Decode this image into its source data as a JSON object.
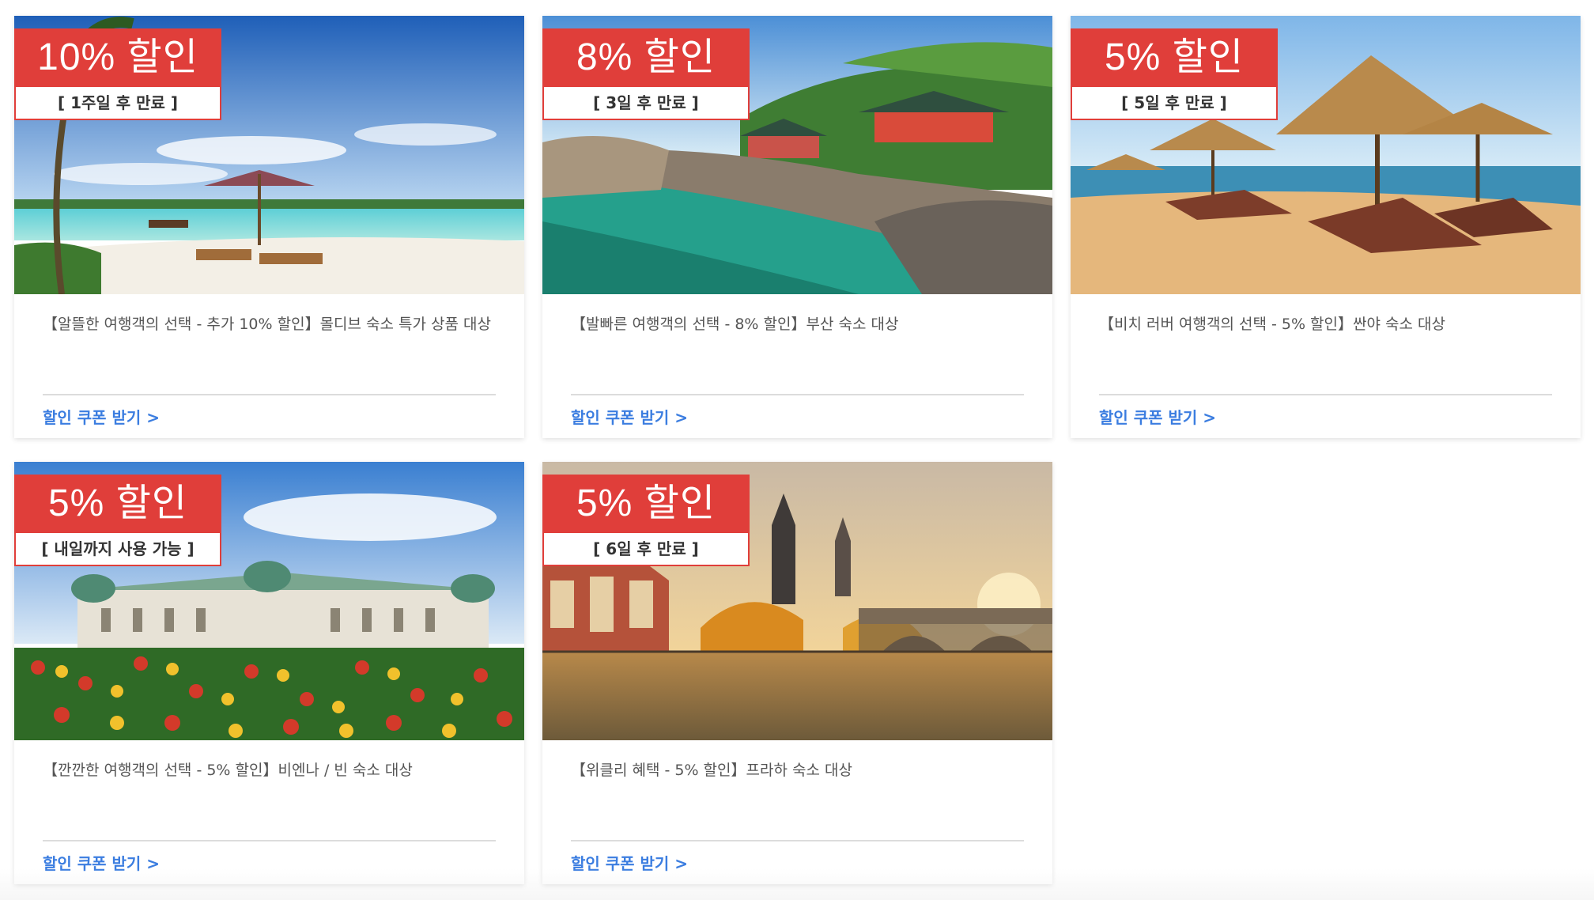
{
  "cards": [
    {
      "discount": "10% 할인",
      "expiry": "[ 1주일 후 만료 ]",
      "title": "【알뜰한 여행객의 선택 - 추가 10% 할인】몰디브 숙소 특가 상품 대상",
      "link": "할인 쿠폰 받기 >",
      "image": "maldives-beach"
    },
    {
      "discount": "8% 할인",
      "expiry": "[ 3일 후 만료 ]",
      "title": "【발빠른 여행객의 선택 - 8% 할인】부산 숙소 대상",
      "link": "할인 쿠폰 받기 >",
      "image": "busan-temple-coast"
    },
    {
      "discount": "5% 할인",
      "expiry": "[ 5일 후 만료 ]",
      "title": "【비치 러버 여행객의 선택 - 5% 할인】싼야 숙소 대상",
      "link": "할인 쿠폰 받기 >",
      "image": "sanya-beach-umbrellas"
    },
    {
      "discount": "5% 할인",
      "expiry": "[ 내일까지 사용 가능 ]",
      "title": "【깐깐한 여행객의 선택 - 5% 할인】비엔나 / 빈 숙소 대상",
      "link": "할인 쿠폰 받기 >",
      "image": "vienna-palace-tulips"
    },
    {
      "discount": "5% 할인",
      "expiry": "[ 6일 후 만료 ]",
      "title": "【위클리 혜택 - 5% 할인】프라하 숙소 대상",
      "link": "할인 쿠폰 받기 >",
      "image": "prague-river-bridge"
    }
  ],
  "colors": {
    "badge": "#e03e3a",
    "link": "#3b7de0",
    "text": "#555555"
  }
}
